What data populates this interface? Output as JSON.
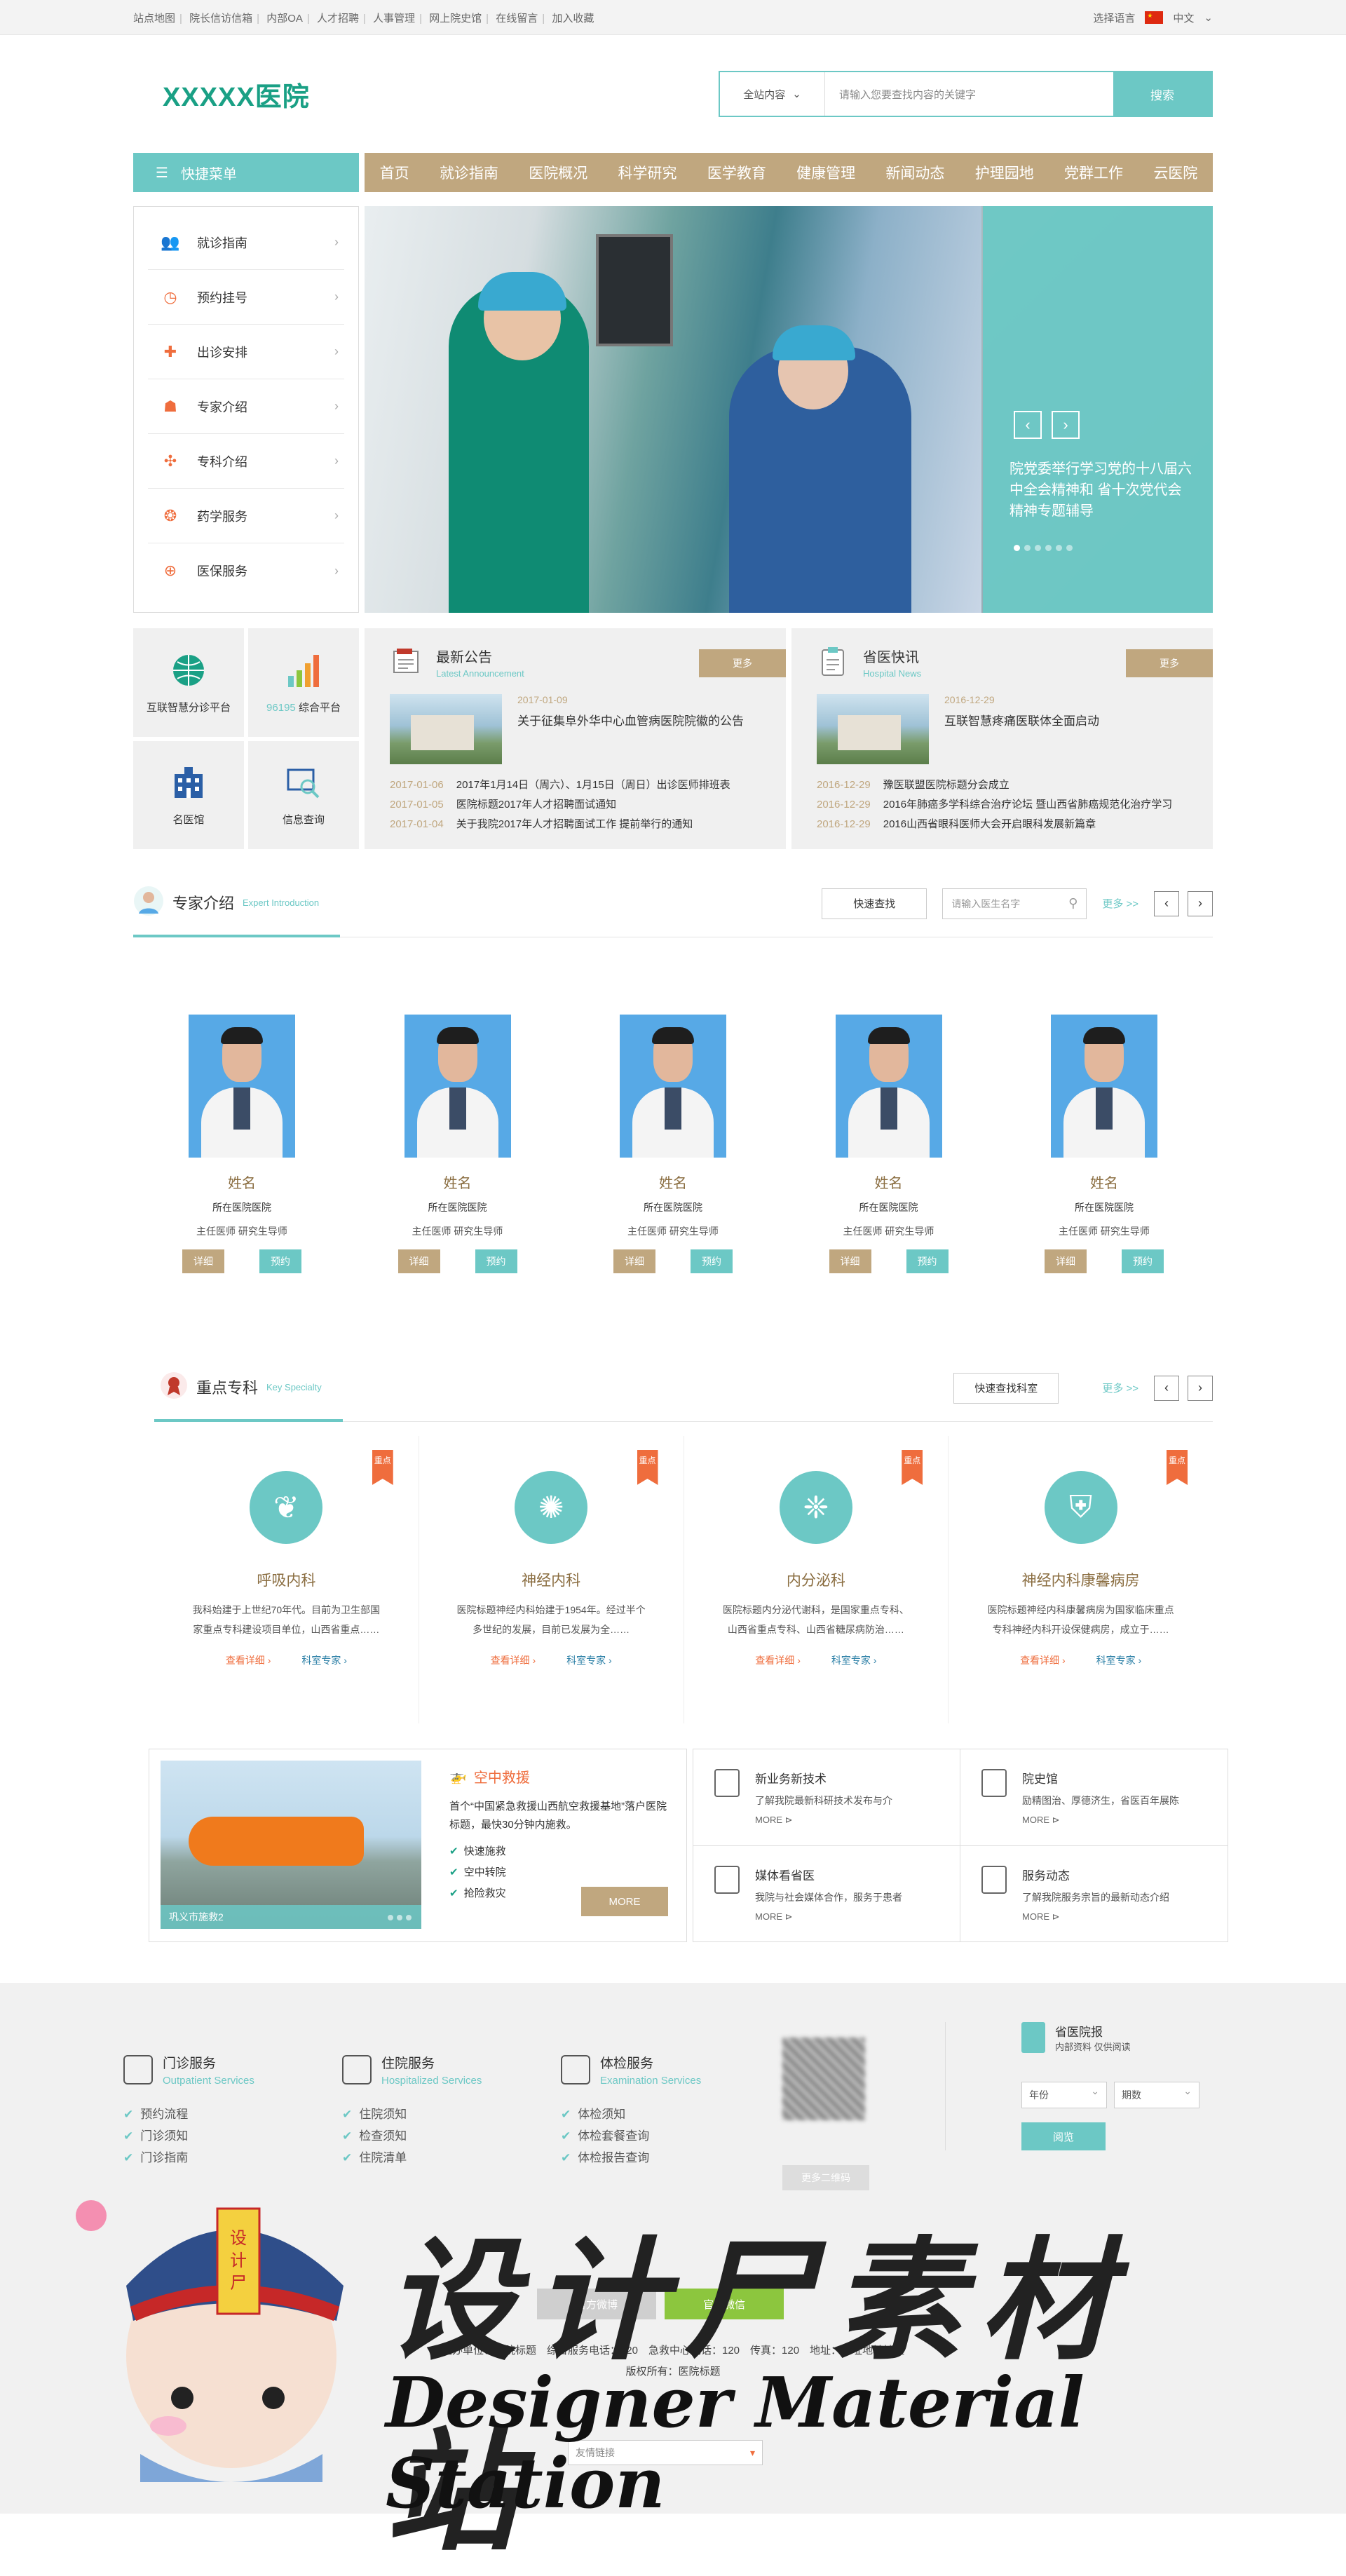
{
  "topbar": {
    "links": [
      "站点地图",
      "院长信访信箱",
      "内部OA",
      "人才招聘",
      "人事管理",
      "网上院史馆",
      "在线留言",
      "加入收藏"
    ],
    "lang_label": "选择语言",
    "lang_value": "中文"
  },
  "header": {
    "logo": "XXXXX医院",
    "search_scope": "全站内容",
    "search_placeholder": "请输入您要查找内容的关键字",
    "search_button": "搜索"
  },
  "nav": {
    "quick_menu": "快捷菜单",
    "items": [
      "首页",
      "就诊指南",
      "医院概况",
      "科学研究",
      "医学教育",
      "健康管理",
      "新闻动态",
      "护理园地",
      "党群工作",
      "云医院"
    ]
  },
  "sidemenu": [
    "就诊指南",
    "预约挂号",
    "出诊安排",
    "专家介绍",
    "专科介绍",
    "药学服务",
    "医保服务"
  ],
  "banner": {
    "caption": "院党委举行学习党的十八届六中全会精神和 省十次党代会精神专题辅导"
  },
  "tiles": [
    {
      "label": "互联智慧分诊平台",
      "hl": ""
    },
    {
      "label": "综合平台",
      "hl": "96195"
    },
    {
      "label": "名医馆",
      "hl": ""
    },
    {
      "label": "信息查询",
      "hl": ""
    }
  ],
  "announce": {
    "title": "最新公告",
    "subtitle": "Latest Announcement",
    "more": "更多",
    "lead_date": "2017-01-09",
    "lead_title": "关于征集阜外华中心血管病医院院徽的公告",
    "list": [
      {
        "date": "2017-01-06",
        "text": "2017年1月14日（周六）、1月15日（周日）出诊医师排班表"
      },
      {
        "date": "2017-01-05",
        "text": "医院标题2017年人才招聘面试通知"
      },
      {
        "date": "2017-01-04",
        "text": "关于我院2017年人才招聘面试工作 提前举行的通知"
      }
    ]
  },
  "province": {
    "title": "省医快讯",
    "subtitle": "Hospital News",
    "more": "更多",
    "lead_date": "2016-12-29",
    "lead_title": "互联智慧疼痛医联体全面启动",
    "list": [
      {
        "date": "2016-12-29",
        "text": "豫医联盟医院标题分会成立"
      },
      {
        "date": "2016-12-29",
        "text": "2016年肺癌多学科综合治疗论坛 暨山西省肺癌规范化治疗学习"
      },
      {
        "date": "2016-12-29",
        "text": "2016山西省眼科医师大会开启眼科发展新篇章"
      }
    ]
  },
  "experts_section": {
    "title": "专家介绍",
    "subtitle": "Expert Introduction",
    "quick_find": "快速查找",
    "search_placeholder": "请输入医生名字",
    "more": "更多 >>"
  },
  "experts": [
    {
      "name": "姓名",
      "hospital": "所在医院医院",
      "title": "主任医师 研究生导师",
      "detail": "详细",
      "book": "预约"
    },
    {
      "name": "姓名",
      "hospital": "所在医院医院",
      "title": "主任医师 研究生导师",
      "detail": "详细",
      "book": "预约"
    },
    {
      "name": "姓名",
      "hospital": "所在医院医院",
      "title": "主任医师 研究生导师",
      "detail": "详细",
      "book": "预约"
    },
    {
      "name": "姓名",
      "hospital": "所在医院医院",
      "title": "主任医师 研究生导师",
      "detail": "详细",
      "book": "预约"
    },
    {
      "name": "姓名",
      "hospital": "所在医院医院",
      "title": "主任医师 研究生导师",
      "detail": "详细",
      "book": "预约"
    }
  ],
  "spec_section": {
    "title": "重点专科",
    "subtitle": "Key Specialty",
    "quick_find": "快速查找科室",
    "more": "更多 >>"
  },
  "specialties": [
    {
      "tag": "重点",
      "name": "呼吸内科",
      "desc": "我科始建于上世纪70年代。目前为卫生部国家重点专科建设项目单位，山西省重点……",
      "link1": "查看详细",
      "link2": "科室专家"
    },
    {
      "tag": "重点",
      "name": "神经内科",
      "desc": "医院标题神经内科始建于1954年。经过半个多世纪的发展，目前已发展为全……",
      "link1": "查看详细",
      "link2": "科室专家"
    },
    {
      "tag": "重点",
      "name": "内分泌科",
      "desc": "医院标题内分泌代谢科，是国家重点专科、山西省重点专科、山西省糖尿病防治……",
      "link1": "查看详细",
      "link2": "科室专家"
    },
    {
      "tag": "重点",
      "name": "神经内科康馨病房",
      "desc": "医院标题神经内科康馨病房为国家临床重点专科神经内科开设保健病房，成立于……",
      "link1": "查看详细",
      "link2": "科室专家"
    }
  ],
  "rescue": {
    "caption": "巩义市施救2",
    "title": "空中救援",
    "desc": "首个“中国紧急救援山西航空救援基地”落户医院标题，最快30分钟内施救。",
    "items": [
      "快速施救",
      "空中转院",
      "抢险救灾"
    ],
    "more": "MORE"
  },
  "services": [
    {
      "title": "新业务新技术",
      "desc": "了解我院最新科研技术发布与介",
      "more": "MORE"
    },
    {
      "title": "院史馆",
      "desc": "励精图治、厚德济生，省医百年展陈",
      "more": "MORE"
    },
    {
      "title": "媒体看省医",
      "desc": "我院与社会媒体合作，服务于患者",
      "more": "MORE"
    },
    {
      "title": "服务动态",
      "desc": "了解我院服务宗旨的最新动态介绍",
      "more": "MORE"
    }
  ],
  "footer": {
    "cols": [
      {
        "title": "门诊服务",
        "sub": "Outpatient Services",
        "items": [
          "预约流程",
          "门诊须知",
          "门诊指南"
        ]
      },
      {
        "title": "住院服务",
        "sub": "Hospitalized Services",
        "items": [
          "住院须知",
          "检查须知",
          "住院清单"
        ]
      },
      {
        "title": "体检服务",
        "sub": "Examination Services",
        "items": [
          "体检须知",
          "体检套餐查询",
          "体检报告查询"
        ]
      }
    ],
    "qr_button": "更多二维码",
    "paper_title": "省医院报",
    "paper_sub": "内部资料 仅供阅读",
    "year": "年份",
    "issue": "期数",
    "read": "阅览",
    "btn1": "官方微博",
    "btn2": "官方微信",
    "info1": "主办单位：医院标题　综合服务电话：120　急救中心电话：120　传真：120　地址：地址地址地址",
    "info2": "版权所有：医院标题",
    "links": "友情链接"
  },
  "watermark": {
    "big": "设计尸素材站",
    "sub": "Designer Material Station",
    "badge": "设计尸"
  }
}
